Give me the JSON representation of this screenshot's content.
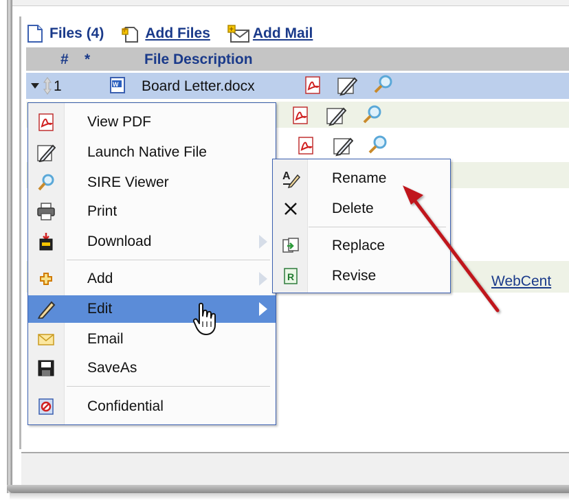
{
  "toolbar": {
    "files_label": "Files (4)",
    "add_files_label": "Add Files",
    "add_mail_label": "Add Mail"
  },
  "grid": {
    "col_number": "#",
    "col_star": "*",
    "col_description": "File Description",
    "selected_row": {
      "index": "1",
      "filename": "Board Letter.docx"
    },
    "link_text": "WebCent"
  },
  "context_menu": {
    "items": [
      {
        "label": "View PDF",
        "icon": "pdf-icon"
      },
      {
        "label": "Launch Native File",
        "icon": "pencil-icon"
      },
      {
        "label": "SIRE Viewer",
        "icon": "magnifier-icon"
      },
      {
        "label": "Print",
        "icon": "printer-icon"
      },
      {
        "label": "Download",
        "icon": "download-icon",
        "has_submenu": true
      },
      {
        "label": "Add",
        "icon": "add-icon",
        "has_submenu": true
      },
      {
        "label": "Edit",
        "icon": "pencil-icon",
        "has_submenu": true,
        "highlighted": true
      },
      {
        "label": "Email",
        "icon": "envelope-icon"
      },
      {
        "label": "SaveAs",
        "icon": "floppy-icon"
      },
      {
        "label": "Confidential",
        "icon": "confidential-icon"
      }
    ]
  },
  "edit_submenu": {
    "items": [
      {
        "label": "Rename",
        "icon": "rename-icon"
      },
      {
        "label": "Delete",
        "icon": "delete-x-icon"
      },
      {
        "label": "Replace",
        "icon": "replace-icon"
      },
      {
        "label": "Revise",
        "icon": "revise-icon"
      }
    ]
  },
  "colors": {
    "header_bg": "#c5c5c5",
    "selected_row_bg": "#bccfec",
    "menu_highlight": "#5b8cd8",
    "link_color": "#1a3a8a",
    "annotation_arrow": "#c0141c"
  }
}
